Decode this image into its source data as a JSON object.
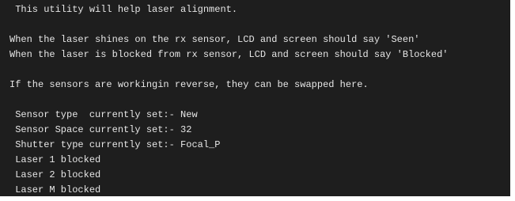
{
  "terminal": {
    "lines": [
      " This utility will help laser alignment.",
      "When the laser shines on the rx sensor, LCD and screen should say 'Seen'",
      "When the laser is blocked from rx sensor, LCD and screen should say 'Blocked'",
      "If the sensors are workingin reverse, they can be swapped here.",
      " Sensor type  currently set:- New",
      " Sensor Space currently set:- 32",
      " Shutter type currently set:- Focal_P",
      " Laser 1 blocked",
      " Laser 2 blocked",
      " Laser M blocked"
    ]
  },
  "colors": {
    "background": "#1e1e1e",
    "text": "#e6e6e6"
  }
}
